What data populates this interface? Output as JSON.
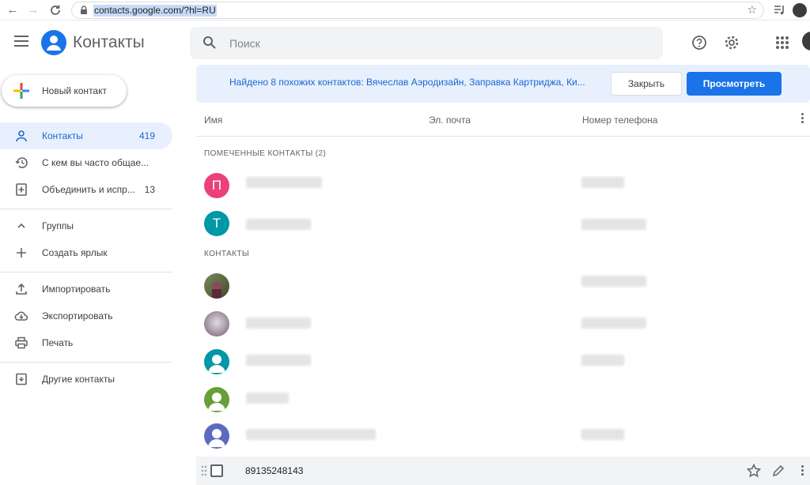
{
  "browser": {
    "url": "contacts.google.com/?hl=RU"
  },
  "header": {
    "app_title": "Контакты",
    "search_placeholder": "Поиск"
  },
  "sidebar": {
    "new_contact": "Новый контакт",
    "items": [
      {
        "label": "Контакты",
        "count": "419",
        "icon": "person-icon",
        "active": true
      },
      {
        "label": "С кем вы часто общае...",
        "count": "",
        "icon": "history-icon"
      },
      {
        "label": "Объединить и испр...",
        "count": "13",
        "icon": "merge-icon"
      }
    ],
    "groups": [
      {
        "label": "Группы",
        "icon": "chevron-up-icon"
      },
      {
        "label": "Создать ярлык",
        "icon": "plus-icon"
      }
    ],
    "actions": [
      {
        "label": "Импортировать",
        "icon": "upload-icon"
      },
      {
        "label": "Экспортировать",
        "icon": "cloud-download-icon"
      },
      {
        "label": "Печать",
        "icon": "printer-icon"
      }
    ],
    "other": {
      "label": "Другие контакты",
      "icon": "archive-icon"
    }
  },
  "banner": {
    "text": "Найдено 8 похожих контактов: Вячеслав Аэродизайн, Заправка Картриджа, Ки...",
    "close_label": "Закрыть",
    "view_label": "Просмотреть"
  },
  "table": {
    "columns": {
      "name": "Имя",
      "email": "Эл. почта",
      "phone": "Номер телефона"
    },
    "starred_section": "ПОМЕЧЕННЫЕ КОНТАКТЫ (2)",
    "contacts_section": "КОНТАКТЫ",
    "starred_rows": [
      {
        "initial": "П",
        "color": "#ec407a"
      },
      {
        "initial": "Т",
        "color": "#0097a7"
      }
    ],
    "hover_row": {
      "name": "89135248143"
    }
  },
  "colors": {
    "accent": "#1a73e8",
    "active_bg": "#e8f0fe"
  }
}
